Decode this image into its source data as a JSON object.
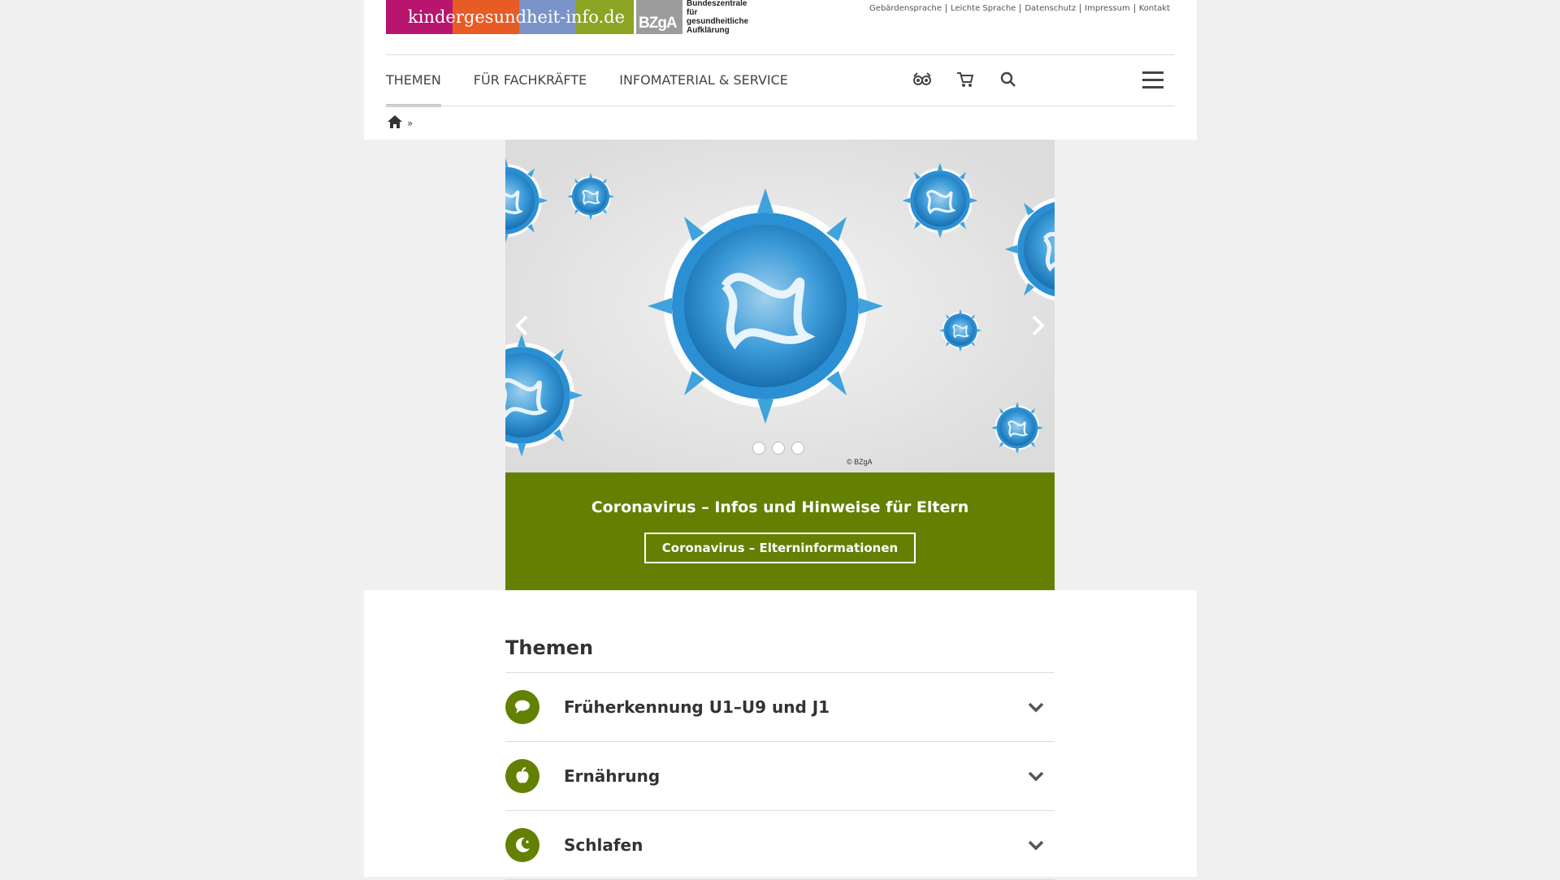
{
  "logo": {
    "text": "kindergesundheit-info.de",
    "colors": [
      "#b8156e",
      "#e85b24",
      "#7a93c8",
      "#8ba424"
    ],
    "bzga_short": "BZgA",
    "bzga_full": "Bundeszentrale\nfür\ngesundheitliche\nAufklärung"
  },
  "meta_nav": [
    "Gebärdensprache",
    "Leichte Sprache",
    "Datenschutz",
    "Impressum",
    "Kontakt"
  ],
  "main_nav": [
    "THEMEN",
    "FÜR FACHKRÄFTE",
    "INFOMATERIAL & SERVICE"
  ],
  "tools": [
    "sign-language-icon",
    "cart-icon",
    "search-icon",
    "menu-icon"
  ],
  "breadcrumb": {
    "icon": "home-icon",
    "separator": "»"
  },
  "hero": {
    "credit": "© BZgA",
    "slides": 3,
    "title": "Coronavirus – Infos und Hinweise für Eltern",
    "button": "Coronavirus – Elterninformationen",
    "accent": "#638003"
  },
  "themen": {
    "heading": "Themen",
    "items": [
      {
        "label": "Früherkennung U1–U9 und J1",
        "icon": "speech-bubble-icon"
      },
      {
        "label": "Ernährung",
        "icon": "apple-icon"
      },
      {
        "label": "Schlafen",
        "icon": "moon-icon"
      }
    ]
  }
}
